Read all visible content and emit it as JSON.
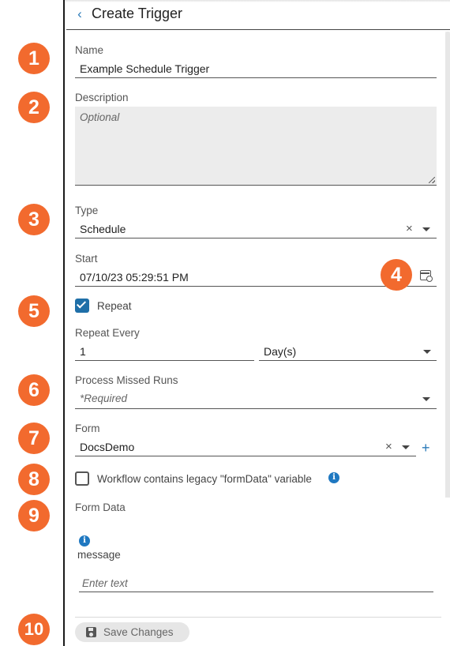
{
  "header": {
    "title": "Create Trigger",
    "back_icon": "chevron-left-icon"
  },
  "badges": [
    "1",
    "2",
    "3",
    "4",
    "5",
    "6",
    "7",
    "8",
    "9",
    "10"
  ],
  "fields": {
    "name": {
      "label": "Name",
      "value": "Example Schedule Trigger"
    },
    "description": {
      "label": "Description",
      "placeholder": "Optional"
    },
    "type": {
      "label": "Type",
      "value": "Schedule"
    },
    "start": {
      "label": "Start",
      "value": "07/10/23 05:29:51 PM"
    },
    "repeat": {
      "label": "Repeat",
      "checked": true
    },
    "repeat_every": {
      "label": "Repeat Every",
      "value": "1",
      "unit": "Day(s)"
    },
    "process_missed_runs": {
      "label": "Process Missed Runs",
      "placeholder": "*Required"
    },
    "form": {
      "label": "Form",
      "value": "DocsDemo"
    },
    "legacy_form_data": {
      "label": "Workflow contains legacy \"formData\" variable",
      "checked": false
    },
    "form_data": {
      "label": "Form Data",
      "message_label": "message",
      "message_placeholder": "Enter text"
    }
  },
  "save_button": {
    "label": "Save Changes",
    "icon": "floppy-disk-icon"
  },
  "colors": {
    "accent": "#2b7bb9",
    "badge": "#f26a2e",
    "checkbox": "#1f6fa8"
  }
}
